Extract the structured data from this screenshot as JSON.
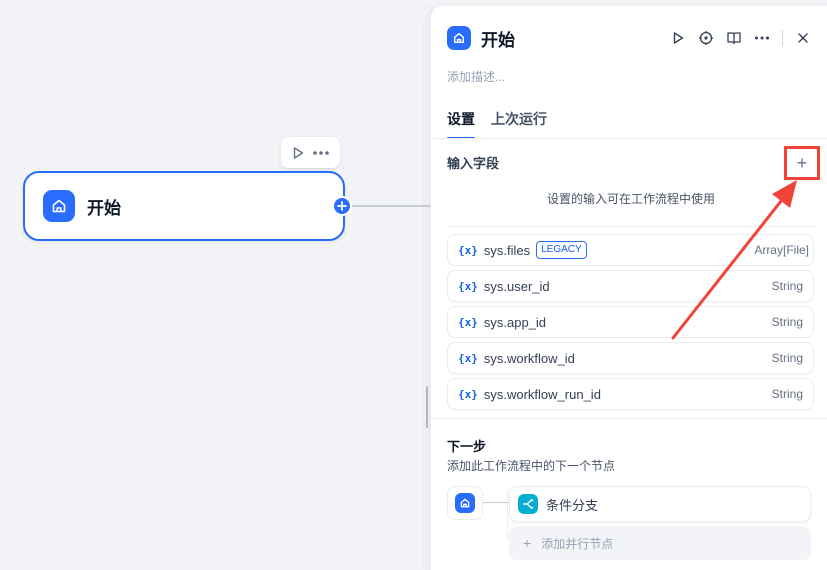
{
  "canvas": {
    "start_node": {
      "title": "开始"
    }
  },
  "panel": {
    "title": "开始",
    "description_placeholder": "添加描述...",
    "tabs": [
      {
        "label": "设置",
        "active": true
      },
      {
        "label": "上次运行",
        "active": false
      }
    ],
    "input_fields": {
      "title": "输入字段",
      "add_label": "+",
      "hint": "设置的输入可在工作流程中使用",
      "variables": [
        {
          "icon": "{x}",
          "name": "sys.files",
          "badge": "LEGACY",
          "type": "Array[File]"
        },
        {
          "icon": "{x}",
          "name": "sys.user_id",
          "badge": "",
          "type": "String"
        },
        {
          "icon": "{x}",
          "name": "sys.app_id",
          "badge": "",
          "type": "String"
        },
        {
          "icon": "{x}",
          "name": "sys.workflow_id",
          "badge": "",
          "type": "String"
        },
        {
          "icon": "{x}",
          "name": "sys.workflow_run_id",
          "badge": "",
          "type": "String"
        }
      ]
    },
    "next_step": {
      "title": "下一步",
      "description": "添加此工作流程中的下一个节点",
      "branch_label": "条件分支",
      "add_parallel_label": "添加并行节点"
    }
  },
  "colors": {
    "accent": "#296dff",
    "annotation": "#f04438",
    "branch": "#06aed4"
  }
}
